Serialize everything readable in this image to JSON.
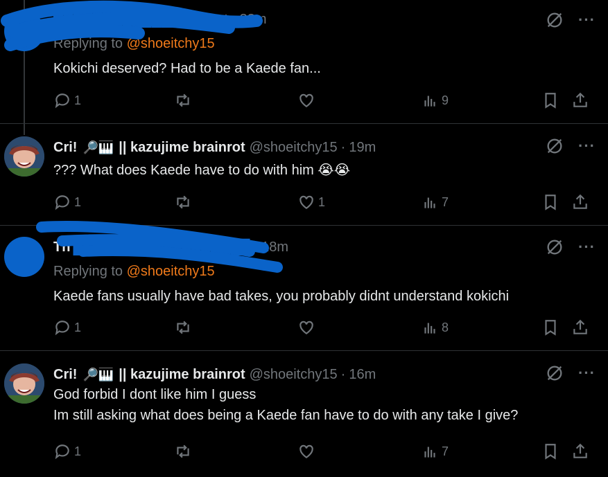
{
  "tweets": [
    {
      "redacted": true,
      "handle_visible": "_rapt",
      "time": "33m",
      "replying_prefix": "Replying to",
      "replying_to": "@shoeitchy15",
      "text": "Kokichi deserved? Had to be a Kaede fan...",
      "reply_count": "1",
      "retweet_count": "",
      "like_count": "",
      "view_count": "9"
    },
    {
      "redacted": false,
      "name": "Cri!",
      "emoji": "🔎🎹",
      "name_suffix": "|| kazujime brainrot",
      "handle": "@shoeitchy15",
      "time": "19m",
      "text": "??? What does Kaede have to do with him",
      "text_emoji": "😭😭",
      "reply_count": "1",
      "retweet_count": "",
      "like_count": "1",
      "view_count": "7"
    },
    {
      "redacted": true,
      "name_visible": "Th",
      "time": "18m",
      "replying_prefix": "Replying to",
      "replying_to": "@shoeitchy15",
      "text": "Kaede fans usually have bad takes, you probably didnt understand kokichi",
      "reply_count": "1",
      "retweet_count": "",
      "like_count": "",
      "view_count": "8"
    },
    {
      "redacted": false,
      "name": "Cri!",
      "emoji": "🔎🎹",
      "name_suffix": "|| kazujime brainrot",
      "handle": "@shoeitchy15",
      "time": "16m",
      "text_line1": "God forbid I dont like him I guess",
      "text_line2": "Im still asking what does being a Kaede fan have to do with any take I give?",
      "reply_count": "1",
      "retweet_count": "",
      "like_count": "",
      "view_count": "7"
    }
  ],
  "icons": {
    "reply": "reply-icon",
    "retweet": "retweet-icon",
    "like": "heart-icon",
    "views": "views-icon",
    "bookmark": "bookmark-icon",
    "share": "share-icon",
    "grok": "grok-icon",
    "more": "more-icon"
  },
  "colors": {
    "background": "#000000",
    "text": "#e7e9ea",
    "muted": "#71767b",
    "mention": "#f07a1a",
    "redaction": "#0a63c9"
  },
  "more_glyph": "···"
}
